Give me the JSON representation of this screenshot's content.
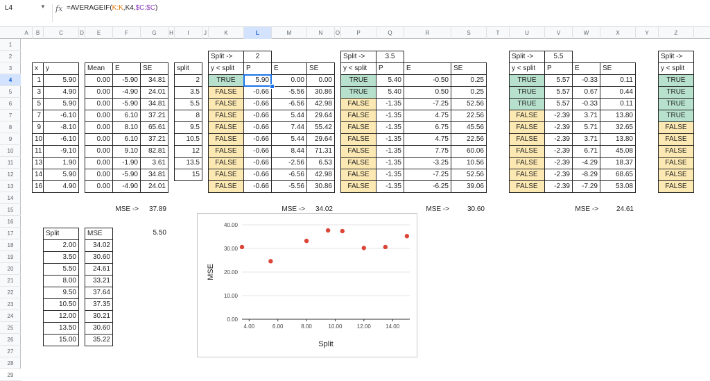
{
  "name_box": "L4",
  "formula": {
    "p1": "=AVERAGEIF(",
    "p2": "K:K",
    "p3": ",K4,",
    "p4": "$C:$C",
    "p5": ")"
  },
  "columns": [
    "A",
    "B",
    "C",
    "D",
    "E",
    "F",
    "G",
    "H",
    "I",
    "J",
    "K",
    "L",
    "M",
    "N",
    "O",
    "P",
    "Q",
    "R",
    "S",
    "T",
    "U",
    "V",
    "W",
    "X",
    "Y",
    "Z"
  ],
  "rows": [
    "1",
    "2",
    "3",
    "4",
    "5",
    "6",
    "7",
    "8",
    "9",
    "10",
    "11",
    "12",
    "13",
    "14",
    "15",
    "16",
    "17",
    "18",
    "19",
    "20",
    "21",
    "22",
    "23",
    "24",
    "25",
    "26",
    "27",
    "28",
    "29"
  ],
  "selected_column": "L",
  "selected_row": "4",
  "data_table": {
    "headers": [
      "x",
      "y"
    ],
    "x": [
      "1",
      "3",
      "5",
      "7",
      "9",
      "10",
      "11",
      "13",
      "14",
      "16"
    ],
    "y": [
      "5.90",
      "4.90",
      "5.90",
      "-6.10",
      "-8.10",
      "-6.10",
      "-9.10",
      "1.90",
      "5.90",
      "4.90"
    ]
  },
  "baseline": {
    "headers": [
      "Mean",
      "E",
      "SE"
    ],
    "rows": [
      [
        "0.00",
        "-5.90",
        "34.81"
      ],
      [
        "0.00",
        "-4.90",
        "24.01"
      ],
      [
        "0.00",
        "-5.90",
        "34.81"
      ],
      [
        "0.00",
        "6.10",
        "37.21"
      ],
      [
        "0.00",
        "8.10",
        "65.61"
      ],
      [
        "0.00",
        "6.10",
        "37.21"
      ],
      [
        "0.00",
        "9.10",
        "82.81"
      ],
      [
        "0.00",
        "-1.90",
        "3.61"
      ],
      [
        "0.00",
        "-5.90",
        "34.81"
      ],
      [
        "0.00",
        "-4.90",
        "24.01"
      ]
    ],
    "mse_label": "MSE ->",
    "mse": "37.89"
  },
  "splits_list": {
    "header": "split",
    "values": [
      "2",
      "3.5",
      "5.5",
      "8",
      "9.5",
      "10.5",
      "12",
      "13.5",
      "15"
    ]
  },
  "split_blocks": [
    {
      "label": "Split ->",
      "value": "2",
      "headers": [
        "y < split",
        "P",
        "E",
        "SE"
      ],
      "rows": [
        [
          "TRUE",
          "5.90",
          "0.00",
          "0.00"
        ],
        [
          "FALSE",
          "-0.66",
          "-5.56",
          "30.86"
        ],
        [
          "FALSE",
          "-0.66",
          "-6.56",
          "42.98"
        ],
        [
          "FALSE",
          "-0.66",
          "5.44",
          "29.64"
        ],
        [
          "FALSE",
          "-0.66",
          "7.44",
          "55.42"
        ],
        [
          "FALSE",
          "-0.66",
          "5.44",
          "29.64"
        ],
        [
          "FALSE",
          "-0.66",
          "8.44",
          "71.31"
        ],
        [
          "FALSE",
          "-0.66",
          "-2.56",
          "6.53"
        ],
        [
          "FALSE",
          "-0.66",
          "-6.56",
          "42.98"
        ],
        [
          "FALSE",
          "-0.66",
          "-5.56",
          "30.86"
        ]
      ],
      "mse_label": "MSE ->",
      "mse": "34.02"
    },
    {
      "label": "Split ->",
      "value": "3.5",
      "headers": [
        "y < split",
        "P",
        "E",
        "SE"
      ],
      "rows": [
        [
          "TRUE",
          "5.40",
          "-0.50",
          "0.25"
        ],
        [
          "TRUE",
          "5.40",
          "0.50",
          "0.25"
        ],
        [
          "FALSE",
          "-1.35",
          "-7.25",
          "52.56"
        ],
        [
          "FALSE",
          "-1.35",
          "4.75",
          "22.56"
        ],
        [
          "FALSE",
          "-1.35",
          "6.75",
          "45.56"
        ],
        [
          "FALSE",
          "-1.35",
          "4.75",
          "22.56"
        ],
        [
          "FALSE",
          "-1.35",
          "7.75",
          "60.06"
        ],
        [
          "FALSE",
          "-1.35",
          "-3.25",
          "10.56"
        ],
        [
          "FALSE",
          "-1.35",
          "-7.25",
          "52.56"
        ],
        [
          "FALSE",
          "-1.35",
          "-6.25",
          "39.06"
        ]
      ],
      "mse_label": "MSE ->",
      "mse": "30.60"
    },
    {
      "label": "Split ->",
      "value": "5.5",
      "headers": [
        "y < split",
        "P",
        "E",
        "SE"
      ],
      "rows": [
        [
          "TRUE",
          "5.57",
          "-0.33",
          "0.11"
        ],
        [
          "TRUE",
          "5.57",
          "0.67",
          "0.44"
        ],
        [
          "TRUE",
          "5.57",
          "-0.33",
          "0.11"
        ],
        [
          "FALSE",
          "-2.39",
          "3.71",
          "13.80"
        ],
        [
          "FALSE",
          "-2.39",
          "5.71",
          "32.65"
        ],
        [
          "FALSE",
          "-2.39",
          "3.71",
          "13.80"
        ],
        [
          "FALSE",
          "-2.39",
          "6.71",
          "45.08"
        ],
        [
          "FALSE",
          "-2.39",
          "-4.29",
          "18.37"
        ],
        [
          "FALSE",
          "-2.39",
          "-8.29",
          "68.65"
        ],
        [
          "FALSE",
          "-2.39",
          "-7.29",
          "53.08"
        ]
      ],
      "mse_label": "MSE ->",
      "mse": "24.61"
    },
    {
      "label": "Split ->",
      "value": "",
      "headers": [
        "y < split"
      ],
      "rows": [
        [
          "TRUE"
        ],
        [
          "TRUE"
        ],
        [
          "TRUE"
        ],
        [
          "TRUE"
        ],
        [
          "FALSE"
        ],
        [
          "FALSE"
        ],
        [
          "FALSE"
        ],
        [
          "FALSE"
        ],
        [
          "FALSE"
        ],
        [
          "FALSE"
        ]
      ],
      "mse_label": "",
      "mse": ""
    }
  ],
  "summary": {
    "headers": [
      "Split",
      "MSE"
    ],
    "rows": [
      [
        "2.00",
        "34.02"
      ],
      [
        "3.50",
        "30.60"
      ],
      [
        "5.50",
        "24.61"
      ],
      [
        "8.00",
        "33.21"
      ],
      [
        "9.50",
        "37.64"
      ],
      [
        "10.50",
        "37.35"
      ],
      [
        "12.00",
        "30.21"
      ],
      [
        "13.50",
        "30.60"
      ],
      [
        "15.00",
        "35.22"
      ]
    ],
    "best": "5.50"
  },
  "colors": {
    "true_fill": "#b7e1cd",
    "false_fill": "#fce8b2",
    "selection": "#1a73e8",
    "point": "#db4437"
  },
  "chart_data": {
    "type": "scatter",
    "title": "",
    "xlabel": "Split",
    "ylabel": "MSE",
    "xlim": [
      3.5,
      15.2
    ],
    "ylim": [
      0,
      40
    ],
    "xticks": [
      "4.00",
      "6.00",
      "8.00",
      "10.00",
      "12.00",
      "14.00"
    ],
    "yticks": [
      "0.00",
      "10.00",
      "20.00",
      "30.00",
      "40.00"
    ],
    "grid": true,
    "points": [
      [
        3.5,
        30.6
      ],
      [
        5.5,
        24.61
      ],
      [
        8,
        33.21
      ],
      [
        9.5,
        37.64
      ],
      [
        10.5,
        37.35
      ],
      [
        12,
        30.21
      ],
      [
        13.5,
        30.6
      ],
      [
        15,
        35.22
      ]
    ]
  }
}
